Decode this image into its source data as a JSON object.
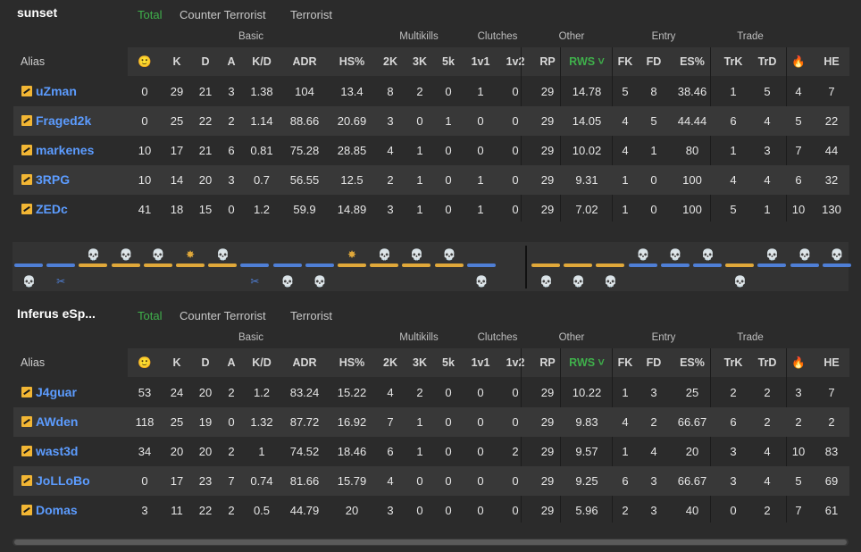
{
  "tabs": [
    "Total",
    "Counter Terrorist",
    "Terrorist"
  ],
  "groups": [
    "Basic",
    "Multikills",
    "Clutches",
    "Other",
    "Entry",
    "Trade"
  ],
  "alias_label": "Alias",
  "columns": [
    "🙂",
    "K",
    "D",
    "A",
    "K/D",
    "ADR",
    "HS%",
    "2K",
    "3K",
    "5k",
    "1v1",
    "1v2",
    "RP",
    "RWS ˅",
    "FK",
    "FD",
    "ES%",
    "TrK",
    "TrD",
    "🔥",
    "HE"
  ],
  "teams": [
    {
      "name": "sunset",
      "players": [
        {
          "name": "uZman",
          "stats": [
            "0",
            "29",
            "21",
            "3",
            "1.38",
            "104",
            "13.4",
            "8",
            "2",
            "0",
            "1",
            "0",
            "29",
            "14.78",
            "5",
            "8",
            "38.46",
            "1",
            "5",
            "4",
            "7"
          ]
        },
        {
          "name": "Fraged2k",
          "stats": [
            "0",
            "25",
            "22",
            "2",
            "1.14",
            "88.66",
            "20.69",
            "3",
            "0",
            "1",
            "0",
            "0",
            "29",
            "14.05",
            "4",
            "5",
            "44.44",
            "6",
            "4",
            "5",
            "22"
          ]
        },
        {
          "name": "markenes",
          "stats": [
            "10",
            "17",
            "21",
            "6",
            "0.81",
            "75.28",
            "28.85",
            "4",
            "1",
            "0",
            "0",
            "0",
            "29",
            "10.02",
            "4",
            "1",
            "80",
            "1",
            "3",
            "7",
            "44"
          ]
        },
        {
          "name": "3RPG",
          "stats": [
            "10",
            "14",
            "20",
            "3",
            "0.7",
            "56.55",
            "12.5",
            "2",
            "1",
            "0",
            "1",
            "0",
            "29",
            "9.31",
            "1",
            "0",
            "100",
            "4",
            "4",
            "6",
            "32"
          ]
        },
        {
          "name": "ZEDc",
          "stats": [
            "41",
            "18",
            "15",
            "0",
            "1.2",
            "59.9",
            "14.89",
            "3",
            "1",
            "0",
            "1",
            "0",
            "29",
            "7.02",
            "1",
            "0",
            "100",
            "5",
            "1",
            "10",
            "130"
          ]
        }
      ]
    },
    {
      "name": "Inferus eSp...",
      "players": [
        {
          "name": "J4guar",
          "stats": [
            "53",
            "24",
            "20",
            "2",
            "1.2",
            "83.24",
            "15.22",
            "4",
            "2",
            "0",
            "0",
            "0",
            "29",
            "10.22",
            "1",
            "3",
            "25",
            "2",
            "2",
            "3",
            "7"
          ]
        },
        {
          "name": "AWden",
          "stats": [
            "118",
            "25",
            "19",
            "0",
            "1.32",
            "87.72",
            "16.92",
            "7",
            "1",
            "0",
            "0",
            "0",
            "29",
            "9.83",
            "4",
            "2",
            "66.67",
            "6",
            "2",
            "2",
            "2"
          ]
        },
        {
          "name": "wast3d",
          "stats": [
            "34",
            "20",
            "20",
            "2",
            "1",
            "74.52",
            "18.46",
            "6",
            "1",
            "0",
            "0",
            "2",
            "29",
            "9.57",
            "1",
            "4",
            "20",
            "3",
            "4",
            "10",
            "83"
          ]
        },
        {
          "name": "JoLLoBo",
          "stats": [
            "0",
            "17",
            "23",
            "7",
            "0.74",
            "81.66",
            "15.79",
            "4",
            "0",
            "0",
            "0",
            "0",
            "29",
            "9.25",
            "6",
            "3",
            "66.67",
            "3",
            "4",
            "5",
            "69"
          ]
        },
        {
          "name": "Domas",
          "stats": [
            "3",
            "11",
            "22",
            "2",
            "0.5",
            "44.79",
            "20",
            "3",
            "0",
            "0",
            "0",
            "0",
            "29",
            "5.96",
            "2",
            "3",
            "40",
            "0",
            "2",
            "7",
            "61"
          ]
        }
      ]
    }
  ],
  "rounds": [
    {
      "side": "ct",
      "icon": "skull",
      "icon_side": "ct"
    },
    {
      "side": "ct",
      "icon": "defuse",
      "icon_side": "ct"
    },
    {
      "side": "t",
      "icon": "skull",
      "icon_side": "t"
    },
    {
      "side": "t",
      "icon": "skull",
      "icon_side": "t"
    },
    {
      "side": "t",
      "icon": "skull",
      "icon_side": "t"
    },
    {
      "side": "t",
      "icon": "explode",
      "icon_side": "t"
    },
    {
      "side": "t",
      "icon": "skull",
      "icon_side": "t"
    },
    {
      "side": "ct",
      "icon": "defuse",
      "icon_side": "ct"
    },
    {
      "side": "ct",
      "icon": "skull",
      "icon_side": "ct"
    },
    {
      "side": "ct",
      "icon": "skull",
      "icon_side": "ct"
    },
    {
      "side": "t",
      "icon": "explode",
      "icon_side": "t"
    },
    {
      "side": "t",
      "icon": "skull",
      "icon_side": "t"
    },
    {
      "side": "t",
      "icon": "skull",
      "icon_side": "t"
    },
    {
      "side": "t",
      "icon": "skull",
      "icon_side": "t"
    },
    {
      "side": "ct",
      "icon": "skull",
      "icon_side": "ct"
    },
    {
      "side": "t",
      "icon": "skull",
      "icon_side": "t"
    },
    {
      "side": "t",
      "icon": "skull",
      "icon_side": "t"
    },
    {
      "side": "t",
      "icon": "skull",
      "icon_side": "t"
    },
    {
      "side": "ct",
      "icon": "skull",
      "icon_side": "ct"
    },
    {
      "side": "ct",
      "icon": "skull",
      "icon_side": "ct"
    },
    {
      "side": "ct",
      "icon": "skull",
      "icon_side": "ct"
    },
    {
      "side": "t",
      "icon": "skull",
      "icon_side": "t"
    },
    {
      "side": "ct",
      "icon": "skull",
      "icon_side": "ct"
    },
    {
      "side": "ct",
      "icon": "skull",
      "icon_side": "ct"
    },
    {
      "side": "ct",
      "icon": "skull",
      "icon_side": "ct"
    }
  ],
  "colors": {
    "accent": "#3fb04b",
    "link": "#5c9cff",
    "ct": "#4f7fd6",
    "t": "#e0a83a"
  }
}
